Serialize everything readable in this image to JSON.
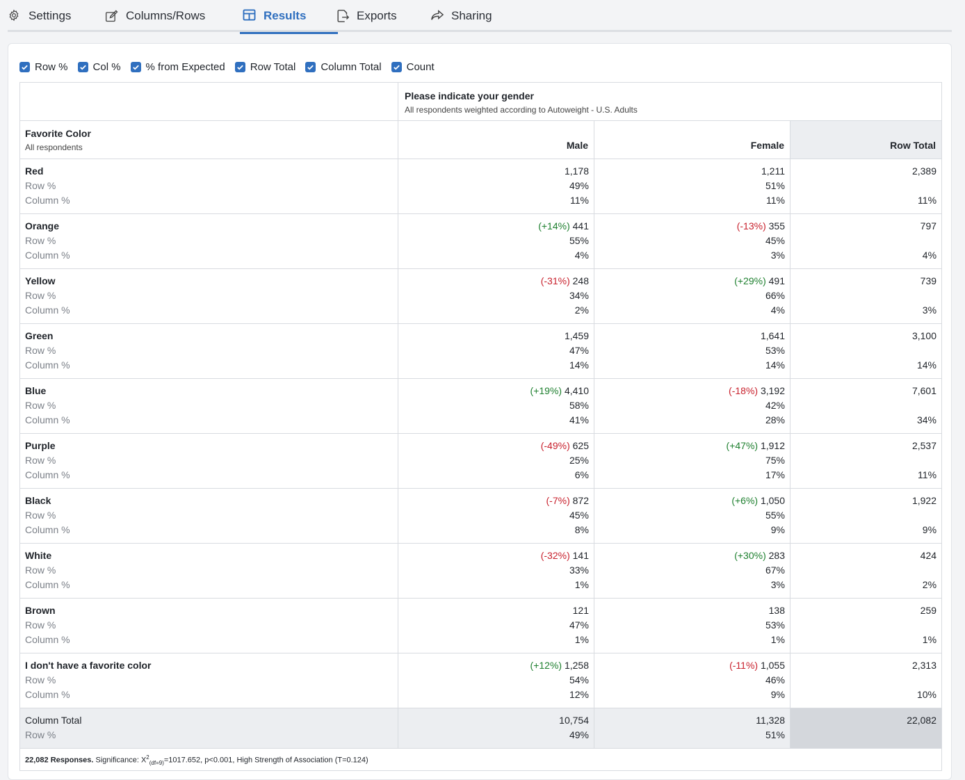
{
  "tabs": [
    {
      "label": "Settings",
      "icon": "gear-icon",
      "active": false
    },
    {
      "label": "Columns/Rows",
      "icon": "edit-icon",
      "active": false
    },
    {
      "label": "Results",
      "icon": "table-icon",
      "active": true
    },
    {
      "label": "Exports",
      "icon": "export-icon",
      "active": false
    },
    {
      "label": "Sharing",
      "icon": "share-icon",
      "active": false
    }
  ],
  "options": [
    {
      "label": "Row %",
      "checked": true
    },
    {
      "label": "Col %",
      "checked": true
    },
    {
      "label": "% from Expected",
      "checked": true
    },
    {
      "label": "Row Total",
      "checked": true
    },
    {
      "label": "Column Total",
      "checked": true
    },
    {
      "label": "Count",
      "checked": true
    }
  ],
  "column_question": {
    "title": "Please indicate your gender",
    "subtitle": "All respondents weighted according to Autoweight - U.S. Adults"
  },
  "row_question": {
    "title": "Favorite Color",
    "subtitle": "All respondents"
  },
  "columns": [
    "Male",
    "Female",
    "Row Total"
  ],
  "labels": {
    "row_pct": "Row %",
    "col_pct": "Column %"
  },
  "rows": [
    {
      "name": "Red",
      "male": {
        "exp": "",
        "count": "1,178",
        "rowp": "49%",
        "colp": "11%"
      },
      "female": {
        "exp": "",
        "count": "1,211",
        "rowp": "51%",
        "colp": "11%"
      },
      "total": {
        "count": "2,389",
        "colp": "11%"
      }
    },
    {
      "name": "Orange",
      "male": {
        "exp": "(+14%)",
        "count": "441",
        "rowp": "55%",
        "colp": "4%"
      },
      "female": {
        "exp": "(-13%)",
        "count": "355",
        "rowp": "45%",
        "colp": "3%"
      },
      "total": {
        "count": "797",
        "colp": "4%"
      }
    },
    {
      "name": "Yellow",
      "male": {
        "exp": "(-31%)",
        "count": "248",
        "rowp": "34%",
        "colp": "2%"
      },
      "female": {
        "exp": "(+29%)",
        "count": "491",
        "rowp": "66%",
        "colp": "4%"
      },
      "total": {
        "count": "739",
        "colp": "3%"
      }
    },
    {
      "name": "Green",
      "male": {
        "exp": "",
        "count": "1,459",
        "rowp": "47%",
        "colp": "14%"
      },
      "female": {
        "exp": "",
        "count": "1,641",
        "rowp": "53%",
        "colp": "14%"
      },
      "total": {
        "count": "3,100",
        "colp": "14%"
      }
    },
    {
      "name": "Blue",
      "male": {
        "exp": "(+19%)",
        "count": "4,410",
        "rowp": "58%",
        "colp": "41%"
      },
      "female": {
        "exp": "(-18%)",
        "count": "3,192",
        "rowp": "42%",
        "colp": "28%"
      },
      "total": {
        "count": "7,601",
        "colp": "34%"
      }
    },
    {
      "name": "Purple",
      "male": {
        "exp": "(-49%)",
        "count": "625",
        "rowp": "25%",
        "colp": "6%"
      },
      "female": {
        "exp": "(+47%)",
        "count": "1,912",
        "rowp": "75%",
        "colp": "17%"
      },
      "total": {
        "count": "2,537",
        "colp": "11%"
      }
    },
    {
      "name": "Black",
      "male": {
        "exp": "(-7%)",
        "count": "872",
        "rowp": "45%",
        "colp": "8%"
      },
      "female": {
        "exp": "(+6%)",
        "count": "1,050",
        "rowp": "55%",
        "colp": "9%"
      },
      "total": {
        "count": "1,922",
        "colp": "9%"
      }
    },
    {
      "name": "White",
      "male": {
        "exp": "(-32%)",
        "count": "141",
        "rowp": "33%",
        "colp": "1%"
      },
      "female": {
        "exp": "(+30%)",
        "count": "283",
        "rowp": "67%",
        "colp": "3%"
      },
      "total": {
        "count": "424",
        "colp": "2%"
      }
    },
    {
      "name": "Brown",
      "male": {
        "exp": "",
        "count": "121",
        "rowp": "47%",
        "colp": "1%"
      },
      "female": {
        "exp": "",
        "count": "138",
        "rowp": "53%",
        "colp": "1%"
      },
      "total": {
        "count": "259",
        "colp": "1%"
      }
    },
    {
      "name": "I don't have a favorite color",
      "male": {
        "exp": "(+12%)",
        "count": "1,258",
        "rowp": "54%",
        "colp": "12%"
      },
      "female": {
        "exp": "(-11%)",
        "count": "1,055",
        "rowp": "46%",
        "colp": "9%"
      },
      "total": {
        "count": "2,313",
        "colp": "10%"
      }
    }
  ],
  "column_total": {
    "label": "Column Total",
    "row_label": "Row %",
    "male": {
      "count": "10,754",
      "rowp": "49%"
    },
    "female": {
      "count": "11,328",
      "rowp": "51%"
    },
    "total": {
      "count": "22,082"
    }
  },
  "footer": {
    "responses": "22,082 Responses.",
    "sig_prefix": "Significance: X",
    "sup": "2",
    "sub": "(df=9)",
    "sig_rest": "=1017.652, p<0.001, High Strength of Association (T=0.124)"
  },
  "colors": {
    "accent": "#2f6fbf",
    "positive": "#1d7f2e",
    "negative": "#c8202c"
  }
}
